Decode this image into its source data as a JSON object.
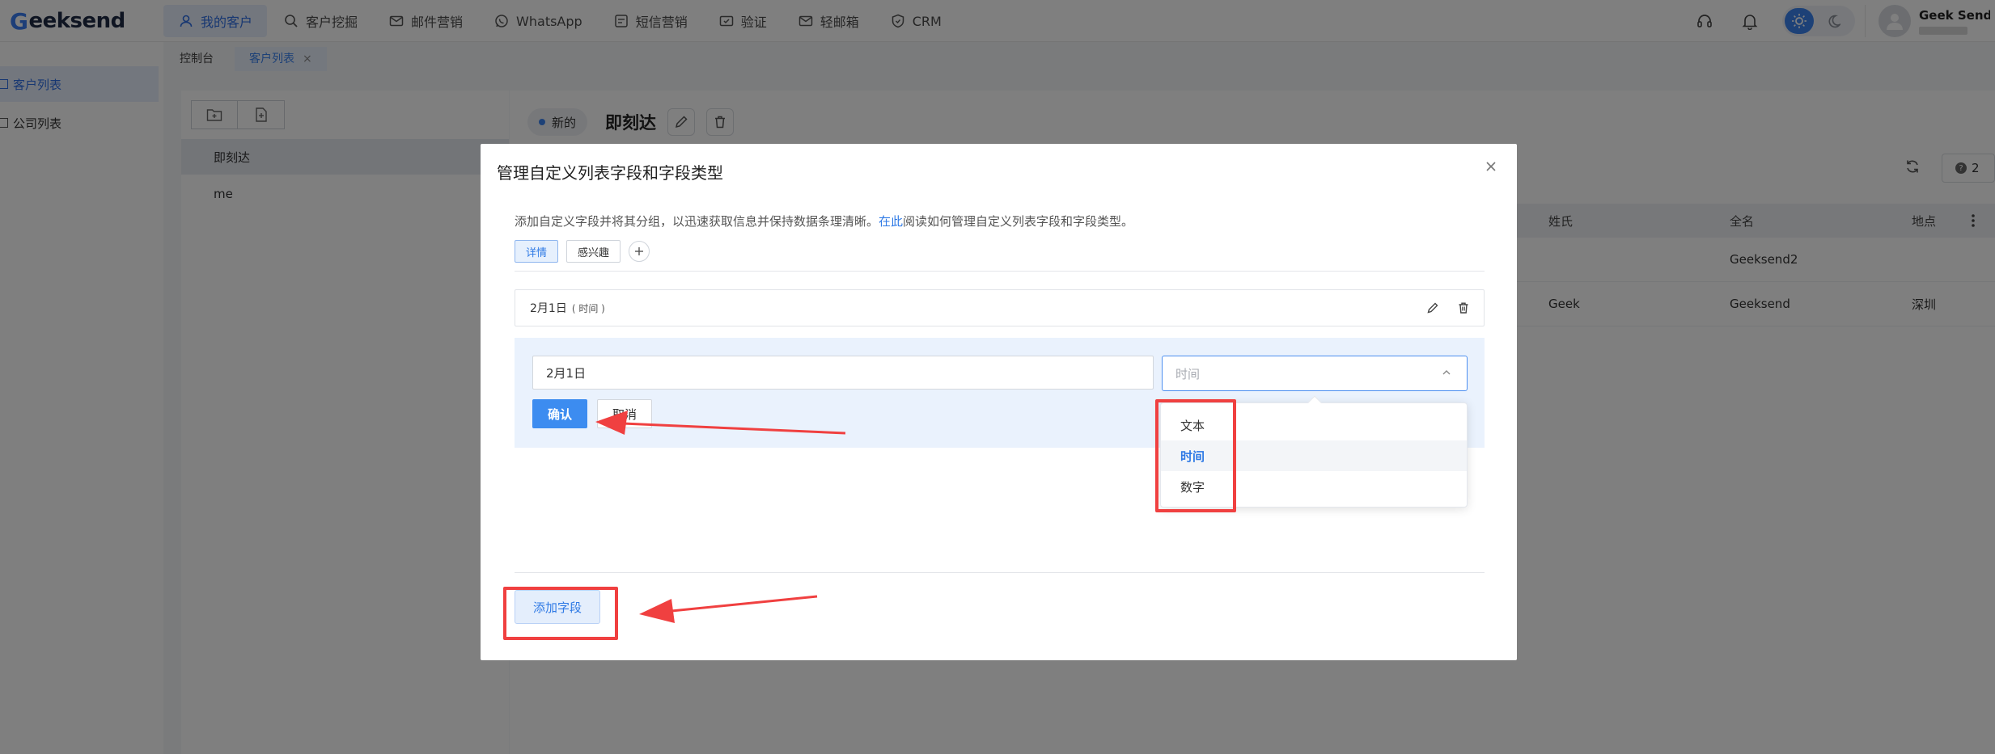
{
  "brand": {
    "logo_text": "eeksend",
    "logo_mark": "G"
  },
  "nav": {
    "items": [
      {
        "label": "我的客户",
        "icon": "user-icon",
        "active": true
      },
      {
        "label": "客户挖掘",
        "icon": "search-icon",
        "active": false
      },
      {
        "label": "邮件营销",
        "icon": "mail-icon",
        "active": false
      },
      {
        "label": "WhatsApp",
        "icon": "whatsapp-icon",
        "active": false
      },
      {
        "label": "短信营销",
        "icon": "sms-icon",
        "active": false
      },
      {
        "label": "验证",
        "icon": "verify-icon",
        "active": false
      },
      {
        "label": "轻邮箱",
        "icon": "light-mail-icon",
        "active": false
      },
      {
        "label": "CRM",
        "icon": "crm-icon",
        "active": false
      }
    ]
  },
  "user": {
    "name": "Geek Send"
  },
  "tabs": {
    "items": [
      {
        "label": "控制台"
      },
      {
        "label": "客户列表",
        "close": "×"
      }
    ]
  },
  "sidebar": {
    "items": [
      {
        "label": "客户列表"
      },
      {
        "label": "公司列表"
      }
    ]
  },
  "list": {
    "items": [
      {
        "label": "即刻达"
      },
      {
        "label": "me"
      }
    ]
  },
  "main": {
    "badge": "新的",
    "title": "即刻达",
    "help_count": "2",
    "columns": [
      "姓氏",
      "全名",
      "地点"
    ],
    "rows": [
      {
        "surname": "",
        "fullname": "Geeksend2",
        "location": ""
      },
      {
        "surname": "Geek",
        "fullname": "Geeksend",
        "location": "深圳"
      }
    ]
  },
  "modal": {
    "title": "管理自定义列表字段和字段类型",
    "desc_before": "添加自定义字段并将其分组，以迅速获取信息并保持数据条理清晰。",
    "desc_link": "在此",
    "desc_after": "阅读如何管理自定义列表字段和字段类型。",
    "groups": [
      {
        "label": "详情",
        "active": true
      },
      {
        "label": "感兴趣",
        "active": false
      }
    ],
    "field": {
      "name": "2月1日",
      "type_label": "( 时间 )"
    },
    "edit": {
      "name_value": "2月1日",
      "type_placeholder": "时间",
      "confirm_label": "确认",
      "cancel_label": "取消"
    },
    "type_options": [
      {
        "label": "文本"
      },
      {
        "label": "时间",
        "selected": true
      },
      {
        "label": "数字"
      }
    ],
    "add_field_label": "添加字段"
  },
  "colors": {
    "accent": "#3a82ef",
    "annotation": "#f04040"
  }
}
